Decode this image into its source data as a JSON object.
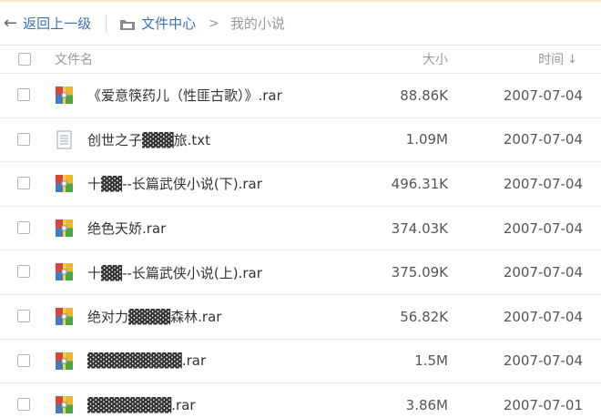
{
  "nav": {
    "back_label": "返回上一级",
    "home_label": "文件中心",
    "current_label": "我的小说"
  },
  "columns": {
    "name": "文件名",
    "size": "大小",
    "time": "时间"
  },
  "files": [
    {
      "name": "《爱意筷药儿（性匪古歌）》.rar",
      "size": "88.86K",
      "time": "2007-07-04",
      "icon": "archive-icon"
    },
    {
      "name": "创世之子▓▓▓旅.txt",
      "size": "1.09M",
      "time": "2007-07-04",
      "icon": "text-file-icon"
    },
    {
      "name": "十▓▓--长篇武侠小说(下).rar",
      "size": "496.31K",
      "time": "2007-07-04",
      "icon": "archive-icon"
    },
    {
      "name": "绝色天娇.rar",
      "size": "374.03K",
      "time": "2007-07-04",
      "icon": "archive-icon"
    },
    {
      "name": "十▓▓--长篇武侠小说(上).rar",
      "size": "375.09K",
      "time": "2007-07-04",
      "icon": "archive-icon"
    },
    {
      "name": "绝对力▓▓▓▓森林.rar",
      "size": "56.82K",
      "time": "2007-07-04",
      "icon": "archive-icon"
    },
    {
      "name": "▓▓▓▓▓▓▓▓▓.rar",
      "size": "1.5M",
      "time": "2007-07-04",
      "icon": "archive-icon"
    },
    {
      "name": "▓▓▓▓▓▓▓▓.rar",
      "size": "3.86M",
      "time": "2007-07-01",
      "icon": "archive-icon"
    }
  ]
}
